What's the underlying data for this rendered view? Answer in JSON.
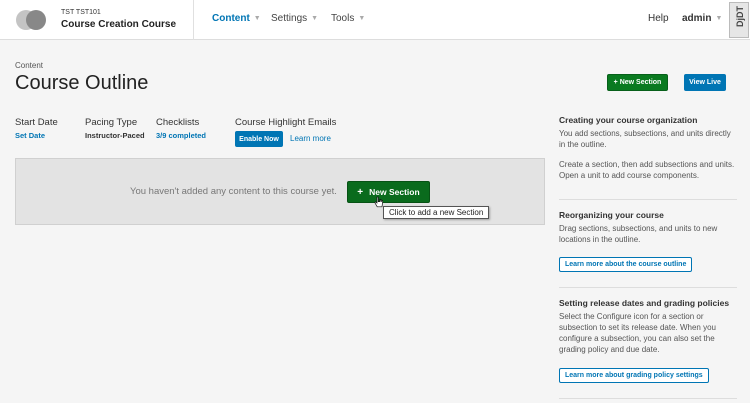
{
  "header": {
    "org": "TST TST101",
    "course_title": "Course Creation Course",
    "nav": {
      "content": "Content",
      "settings": "Settings",
      "tools": "Tools"
    },
    "help": "Help",
    "user": "admin",
    "toolbar_badge": "DjDT"
  },
  "page": {
    "breadcrumb": "Content",
    "title": "Course Outline",
    "new_section_button": "+ New Section",
    "view_live_button": "View Live"
  },
  "info": {
    "start_date_label": "Start Date",
    "start_date_value": "Set Date",
    "pacing_label": "Pacing Type",
    "pacing_value": "Instructor-Paced",
    "checklists_label": "Checklists",
    "checklists_value": "3/9 completed",
    "highlight_label": "Course Highlight Emails",
    "enable_button": "Enable Now",
    "learn_more": "Learn more"
  },
  "outline": {
    "empty_message": "You haven't added any content to this course yet.",
    "new_section_plus": "+",
    "new_section_label": "New Section",
    "tooltip": "Click to add a new Section"
  },
  "sidebar": {
    "org_title": "Creating your course organization",
    "org_text1": "You add sections, subsections, and units directly in the outline.",
    "org_text2": "Create a section, then add subsections and units. Open a unit to add course components.",
    "reorg_title": "Reorganizing your course",
    "reorg_text": "Drag sections, subsections, and units to new locations in the outline.",
    "reorg_button": "Learn more about the course outline",
    "release_title": "Setting release dates and grading policies",
    "release_text": "Select the Configure icon for a section or subsection to set its release date. When you configure a subsection, you can also set the grading policy and due date.",
    "release_button": "Learn more about grading policy settings"
  }
}
